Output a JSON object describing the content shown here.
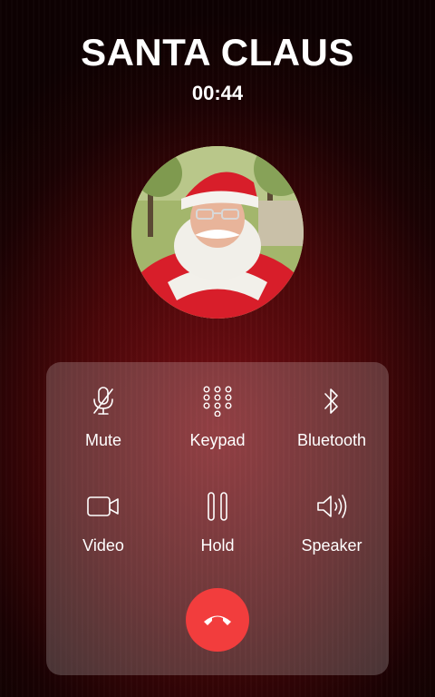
{
  "call": {
    "caller_name": "SANTA CLAUS",
    "timer": "00:44"
  },
  "avatar": {
    "icon": "santa-claus-photo"
  },
  "controls": [
    {
      "id": "mute",
      "label": "Mute",
      "icon": "microphone-off-icon"
    },
    {
      "id": "keypad",
      "label": "Keypad",
      "icon": "keypad-icon"
    },
    {
      "id": "bluetooth",
      "label": "Bluetooth",
      "icon": "bluetooth-icon"
    },
    {
      "id": "video",
      "label": "Video",
      "icon": "video-camera-icon"
    },
    {
      "id": "hold",
      "label": "Hold",
      "icon": "pause-icon"
    },
    {
      "id": "speaker",
      "label": "Speaker",
      "icon": "speaker-icon"
    }
  ],
  "end_call": {
    "icon": "phone-hangup-icon",
    "color": "#f23d3d"
  },
  "colors": {
    "background": "#4a0709",
    "panel": "rgba(255,255,255,0.2)",
    "text": "#ffffff"
  }
}
